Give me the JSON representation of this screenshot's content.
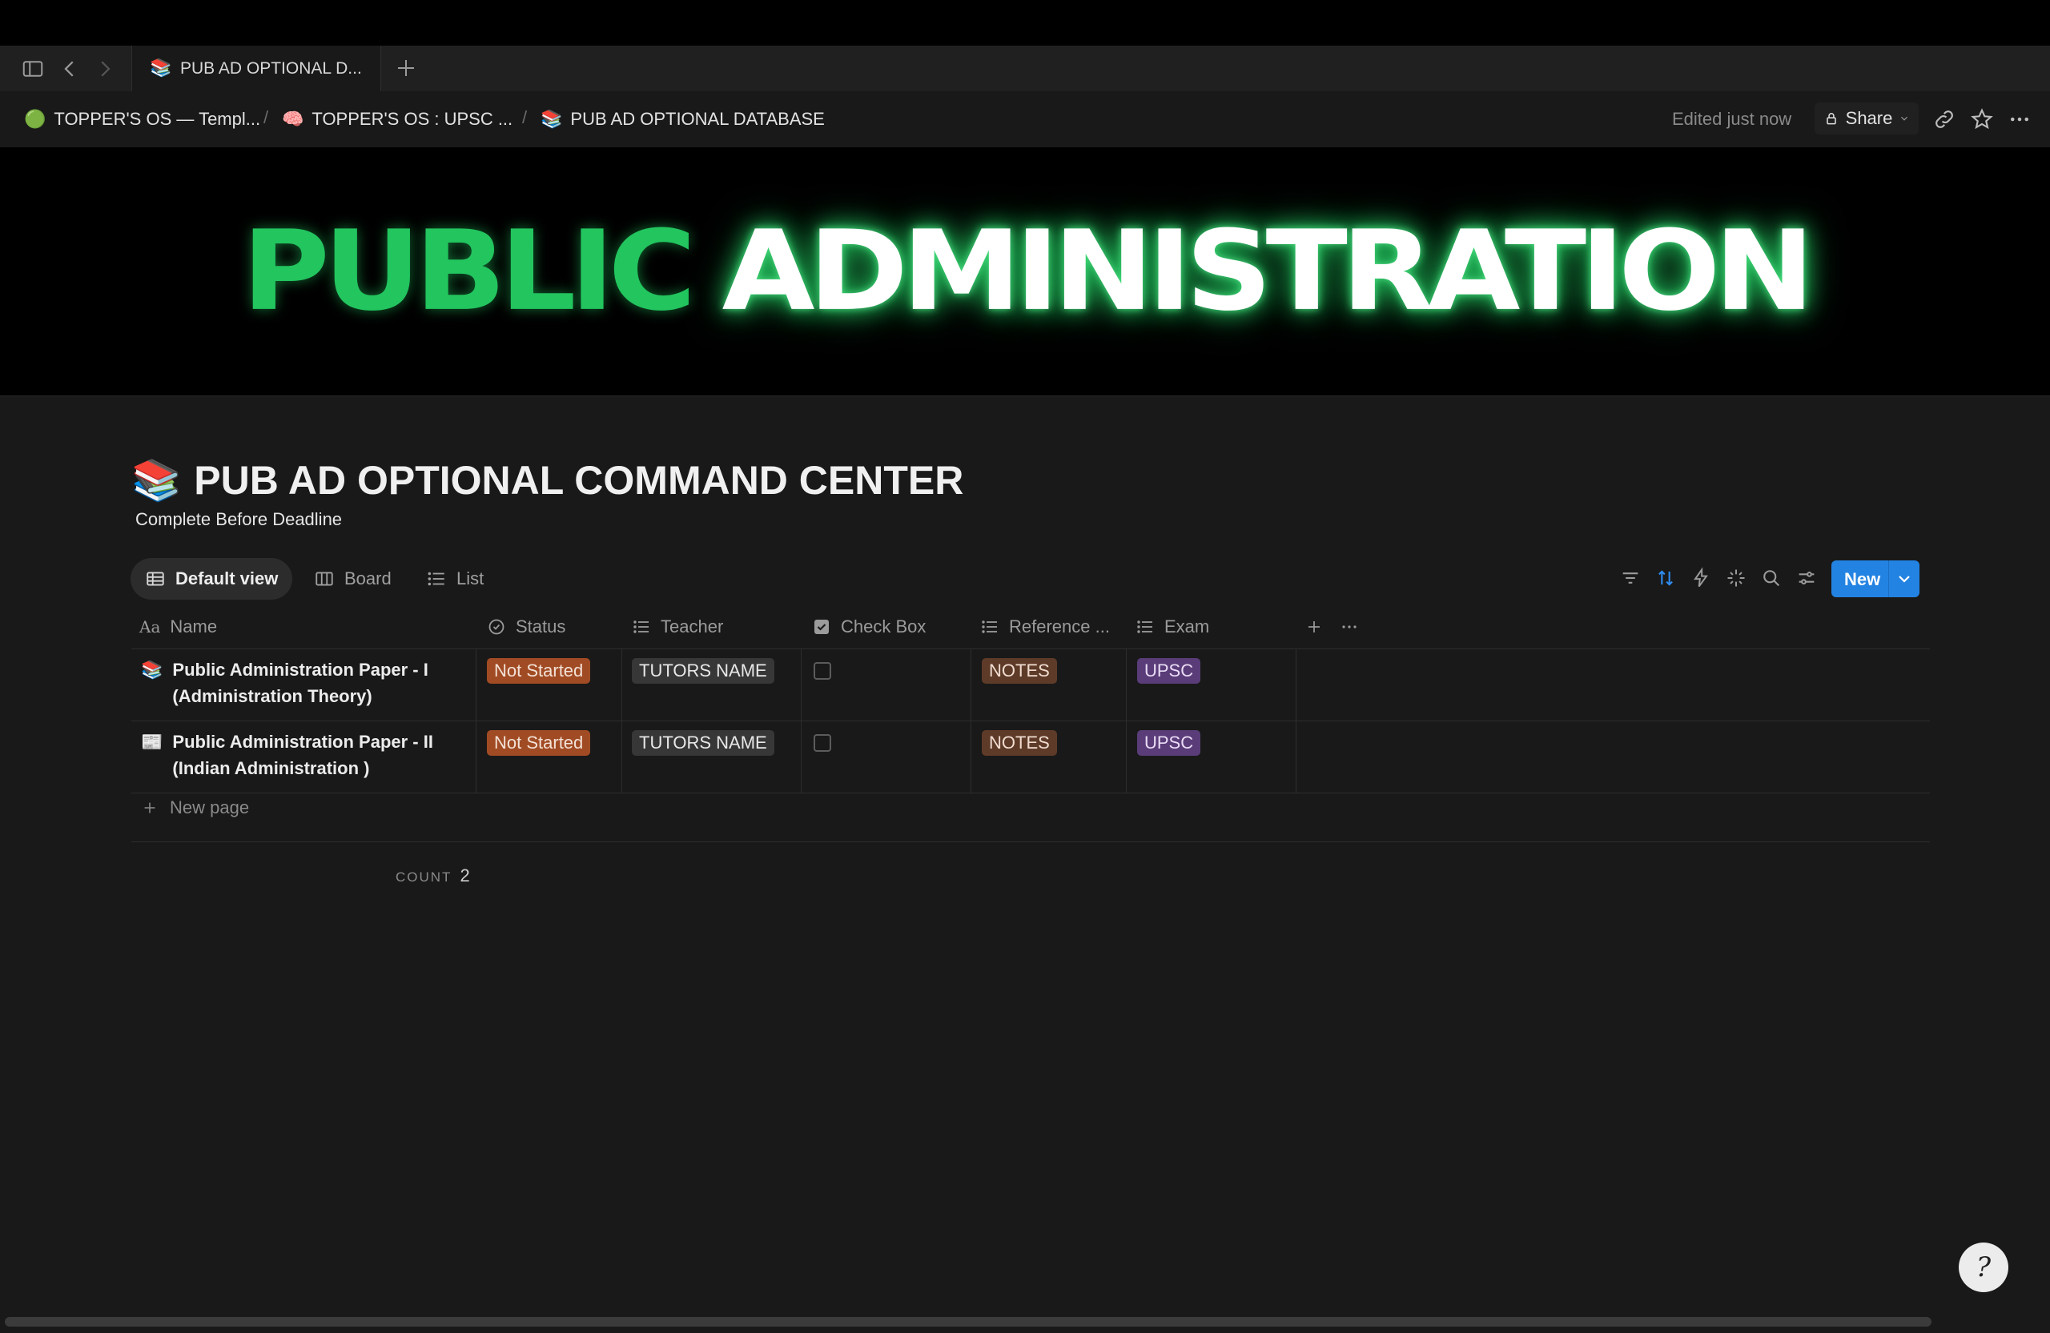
{
  "tabbar": {
    "active_tab": {
      "emoji": "📚",
      "label": "PUB AD OPTIONAL D..."
    }
  },
  "breadcrumbs": [
    {
      "emoji": "🟢",
      "label": "TOPPER'S OS — Templ..."
    },
    {
      "emoji": "🧠",
      "label": "TOPPER'S OS : UPSC ..."
    },
    {
      "emoji": "📚",
      "label": "PUB AD OPTIONAL DATABASE"
    }
  ],
  "breadcrumb_separator": "/",
  "header": {
    "edited": "Edited just now",
    "share_label": "Share"
  },
  "banner": {
    "word1": "PUBLIC",
    "word2": "ADMINISTRATION"
  },
  "page": {
    "emoji": "📚",
    "title": "PUB AD OPTIONAL COMMAND CENTER",
    "description": "Complete Before Deadline"
  },
  "views": [
    {
      "label": "Default view",
      "active": true
    },
    {
      "label": "Board",
      "active": false
    },
    {
      "label": "List",
      "active": false
    }
  ],
  "toolbar": {
    "new_label": "New"
  },
  "table": {
    "columns": [
      "Name",
      "Status",
      "Teacher",
      "Check Box",
      "Reference ...",
      "Exam"
    ],
    "rows": [
      {
        "emoji": "📚",
        "name_line1": "Public Administration Paper - I",
        "name_line2": "(Administration Theory)",
        "status": "Not Started",
        "teacher": "TUTORS NAME",
        "checked": false,
        "reference": "NOTES",
        "exam": "UPSC"
      },
      {
        "emoji": "📰",
        "name_line1": "Public Administration Paper - II",
        "name_line2": "(Indian Administration )",
        "status": "Not Started",
        "teacher": "TUTORS NAME",
        "checked": false,
        "reference": "NOTES",
        "exam": "UPSC"
      }
    ],
    "new_page_label": "New page",
    "count_label": "COUNT",
    "count_value": "2"
  },
  "help": {
    "glyph": "?"
  },
  "colors": {
    "background": "#191919",
    "accent_blue": "#2383e2",
    "banner_green": "#22c55e",
    "status_orange": "#a14b24",
    "exam_purple": "#5a3c79",
    "reference_brown": "#5e3b28"
  }
}
